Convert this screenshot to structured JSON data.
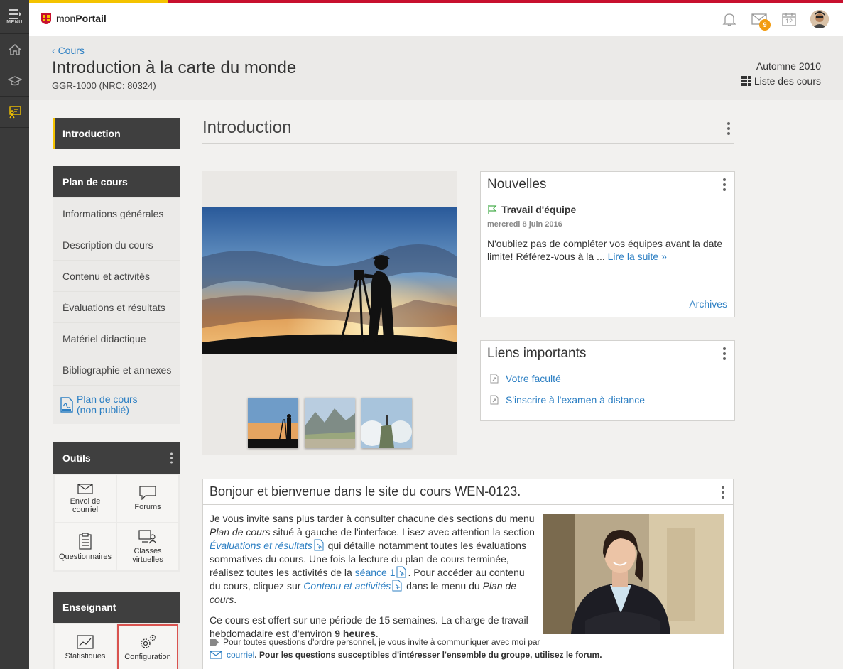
{
  "rail": {
    "menu_label": "MENU"
  },
  "topbar": {
    "brand_prefix": "mon",
    "brand_bold": "Portail",
    "mail_count": "9",
    "calendar_day": "12"
  },
  "header": {
    "back_label": "Cours",
    "course_title": "Introduction à la carte du monde",
    "course_code": "GGR-1000 (NRC: 80324)",
    "session": "Automne 2010",
    "course_list_label": "Liste des cours"
  },
  "sidebar": {
    "introduction": "Introduction",
    "plan_heading": "Plan de cours",
    "plan_items": [
      "Informations générales",
      "Description du cours",
      "Contenu et activités",
      "Évaluations et résultats",
      "Matériel didactique",
      "Bibliographie et annexes"
    ],
    "pdf_line1": "Plan de cours",
    "pdf_line2": "(non publié)",
    "tools_heading": "Outils",
    "tools": [
      "Envoi de courriel",
      "Forums",
      "Questionnaires",
      "Classes virtuelles"
    ],
    "teacher_heading": "Enseignant",
    "teacher_tools": [
      "Statistiques",
      "Configuration"
    ]
  },
  "main": {
    "title": "Introduction"
  },
  "news": {
    "heading": "Nouvelles",
    "item_title": "Travail d'équipe",
    "item_date": "mercredi 8 juin 2016",
    "item_text": "N'oubliez pas de compléter vos équipes avant la date limite! Référez-vous à la ... ",
    "read_more": "Lire la suite »",
    "archives": "Archives"
  },
  "links": {
    "heading": "Liens importants",
    "items": [
      "Votre faculté",
      "S'inscrire à l'examen à distance"
    ]
  },
  "welcome": {
    "heading": "Bonjour et bienvenue dans le site du cours WEN-0123.",
    "p1_a": "Je vous invite sans plus tarder à consulter chacune des sections du menu ",
    "p1_plan": "Plan de cours",
    "p1_b": " situé à gauche de l'interface. Lisez avec attention la section ",
    "p1_eval": "Évaluations et résultats",
    "p1_c": " qui détaille notamment toutes les évaluations sommatives du cours. Une fois la lecture du plan de cours terminée, réalisez toutes les activités de la ",
    "p1_seance": "séance 1",
    "p1_d": ". Pour accéder au contenu du cours, cliquez sur ",
    "p1_contenu": "Contenu et activités",
    "p1_e": " dans le menu du ",
    "p1_plan2": "Plan de cours",
    "p1_f": ".",
    "p2_a": "Ce cours est offert sur une période de 15 semaines. La charge de travail hebdomadaire est d'environ ",
    "p2_bold": "9 heures",
    "p2_b": ".",
    "note1": "Pour toutes questions d'ordre personnel, je vous invite à communiquer avec moi par",
    "note2_link": "courriel",
    "note2_text": ". Pour les questions susceptibles d'intéresser l'ensemble du groupe, utilisez le forum."
  }
}
